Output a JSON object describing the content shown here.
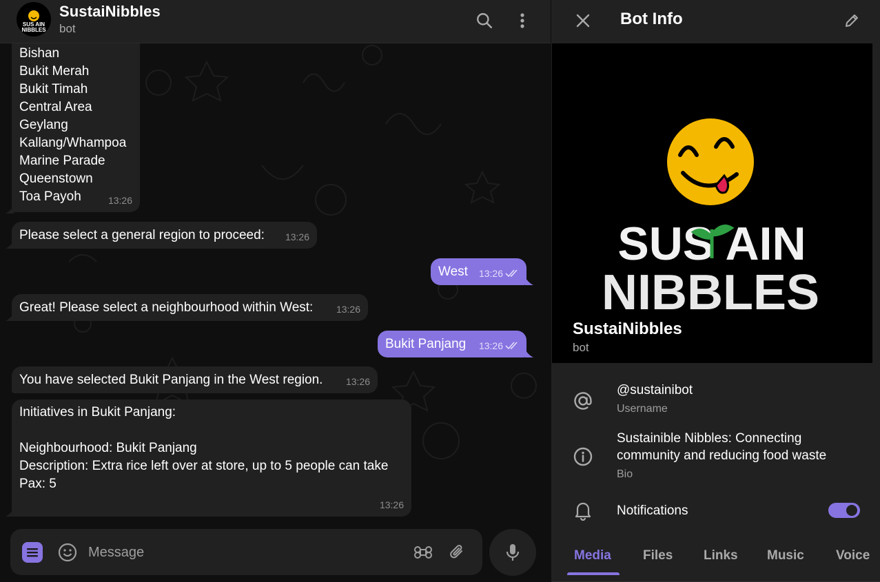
{
  "chat": {
    "title": "SustaiNibbles",
    "subtitle": "bot",
    "composer_placeholder": "Message",
    "messages": [
      {
        "text": "Bishan\nBukit Merah\nBukit Timah\nCentral Area\nGeylang\nKallang/Whampoa\nMarine Parade\nQueenstown\nToa Payoh",
        "time": "13:26",
        "direction": "in"
      },
      {
        "text": "Please select a general region to proceed:",
        "time": "13:26",
        "direction": "in"
      },
      {
        "text": "West",
        "time": "13:26",
        "direction": "out",
        "read": true
      },
      {
        "text": "Great! Please select a neighbourhood within West:",
        "time": "13:26",
        "direction": "in"
      },
      {
        "text": "Bukit Panjang",
        "time": "13:26",
        "direction": "out",
        "read": true
      },
      {
        "text": "You have selected Bukit Panjang in the West region.",
        "time": "13:26",
        "direction": "in"
      },
      {
        "text": "Initiatives in Bukit Panjang:\n\nNeighbourhood: Bukit Panjang\nDescription: Extra rice left over at store, up to 5 people can take\nPax: 5",
        "time": "13:26",
        "direction": "in"
      }
    ]
  },
  "panel": {
    "title": "Bot Info",
    "bot_name": "SustaiNibbles",
    "bot_subtitle": "bot",
    "logo_text": {
      "line1": "SUS AIN",
      "line2": "NIBBLES",
      "avatar_line1": "SUS AIN",
      "avatar_line2": "NIBBLES"
    },
    "username": "@sustainibot",
    "username_label": "Username",
    "bio": "Sustainible Nibbles: Connecting community and reducing food waste",
    "bio_label": "Bio",
    "notifications_label": "Notifications",
    "notifications_on": true,
    "tabs": [
      {
        "label": "Media",
        "active": true
      },
      {
        "label": "Files",
        "active": false
      },
      {
        "label": "Links",
        "active": false
      },
      {
        "label": "Music",
        "active": false
      },
      {
        "label": "Voice",
        "active": false
      }
    ]
  },
  "colors": {
    "accent": "#8774e1",
    "bubble_in": "#212121",
    "background": "#0f0f0f",
    "panel": "#212121",
    "logo_yellow": "#f5b800",
    "logo_green": "#2ea043"
  }
}
